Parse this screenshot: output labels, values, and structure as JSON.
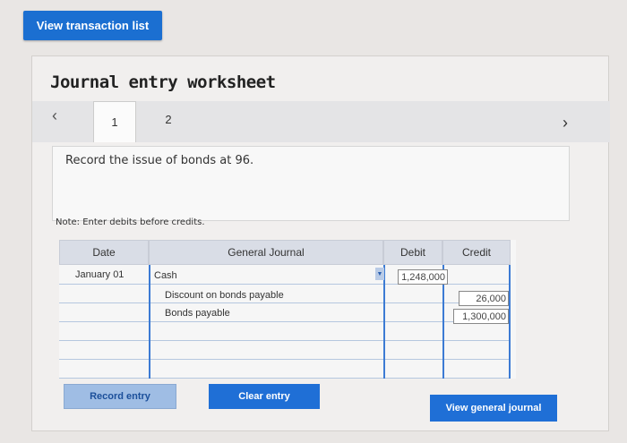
{
  "header": {
    "view_transactions_label": "View transaction list"
  },
  "worksheet": {
    "title": "Journal entry worksheet",
    "tabs": [
      {
        "label": "1"
      },
      {
        "label": "2"
      }
    ],
    "instruction": "Record the issue of bonds at 96.",
    "note": "Note: Enter debits before credits."
  },
  "journal": {
    "columns": {
      "date": "Date",
      "general_journal": "General Journal",
      "debit": "Debit",
      "credit": "Credit"
    },
    "rows": [
      {
        "date": "January 01",
        "account": "Cash",
        "debit": "1,248,000",
        "credit": ""
      },
      {
        "date": "",
        "account": "Discount on bonds payable",
        "debit": "",
        "credit": "26,000"
      },
      {
        "date": "",
        "account": "Bonds payable",
        "debit": "",
        "credit": "1,300,000"
      }
    ]
  },
  "buttons": {
    "record": "Record entry",
    "clear": "Clear entry",
    "view_journal": "View general journal"
  },
  "colors": {
    "primary_button": "#1f6fd6",
    "disabled_button": "#9fbde4",
    "column_line": "#3c7bd4"
  }
}
